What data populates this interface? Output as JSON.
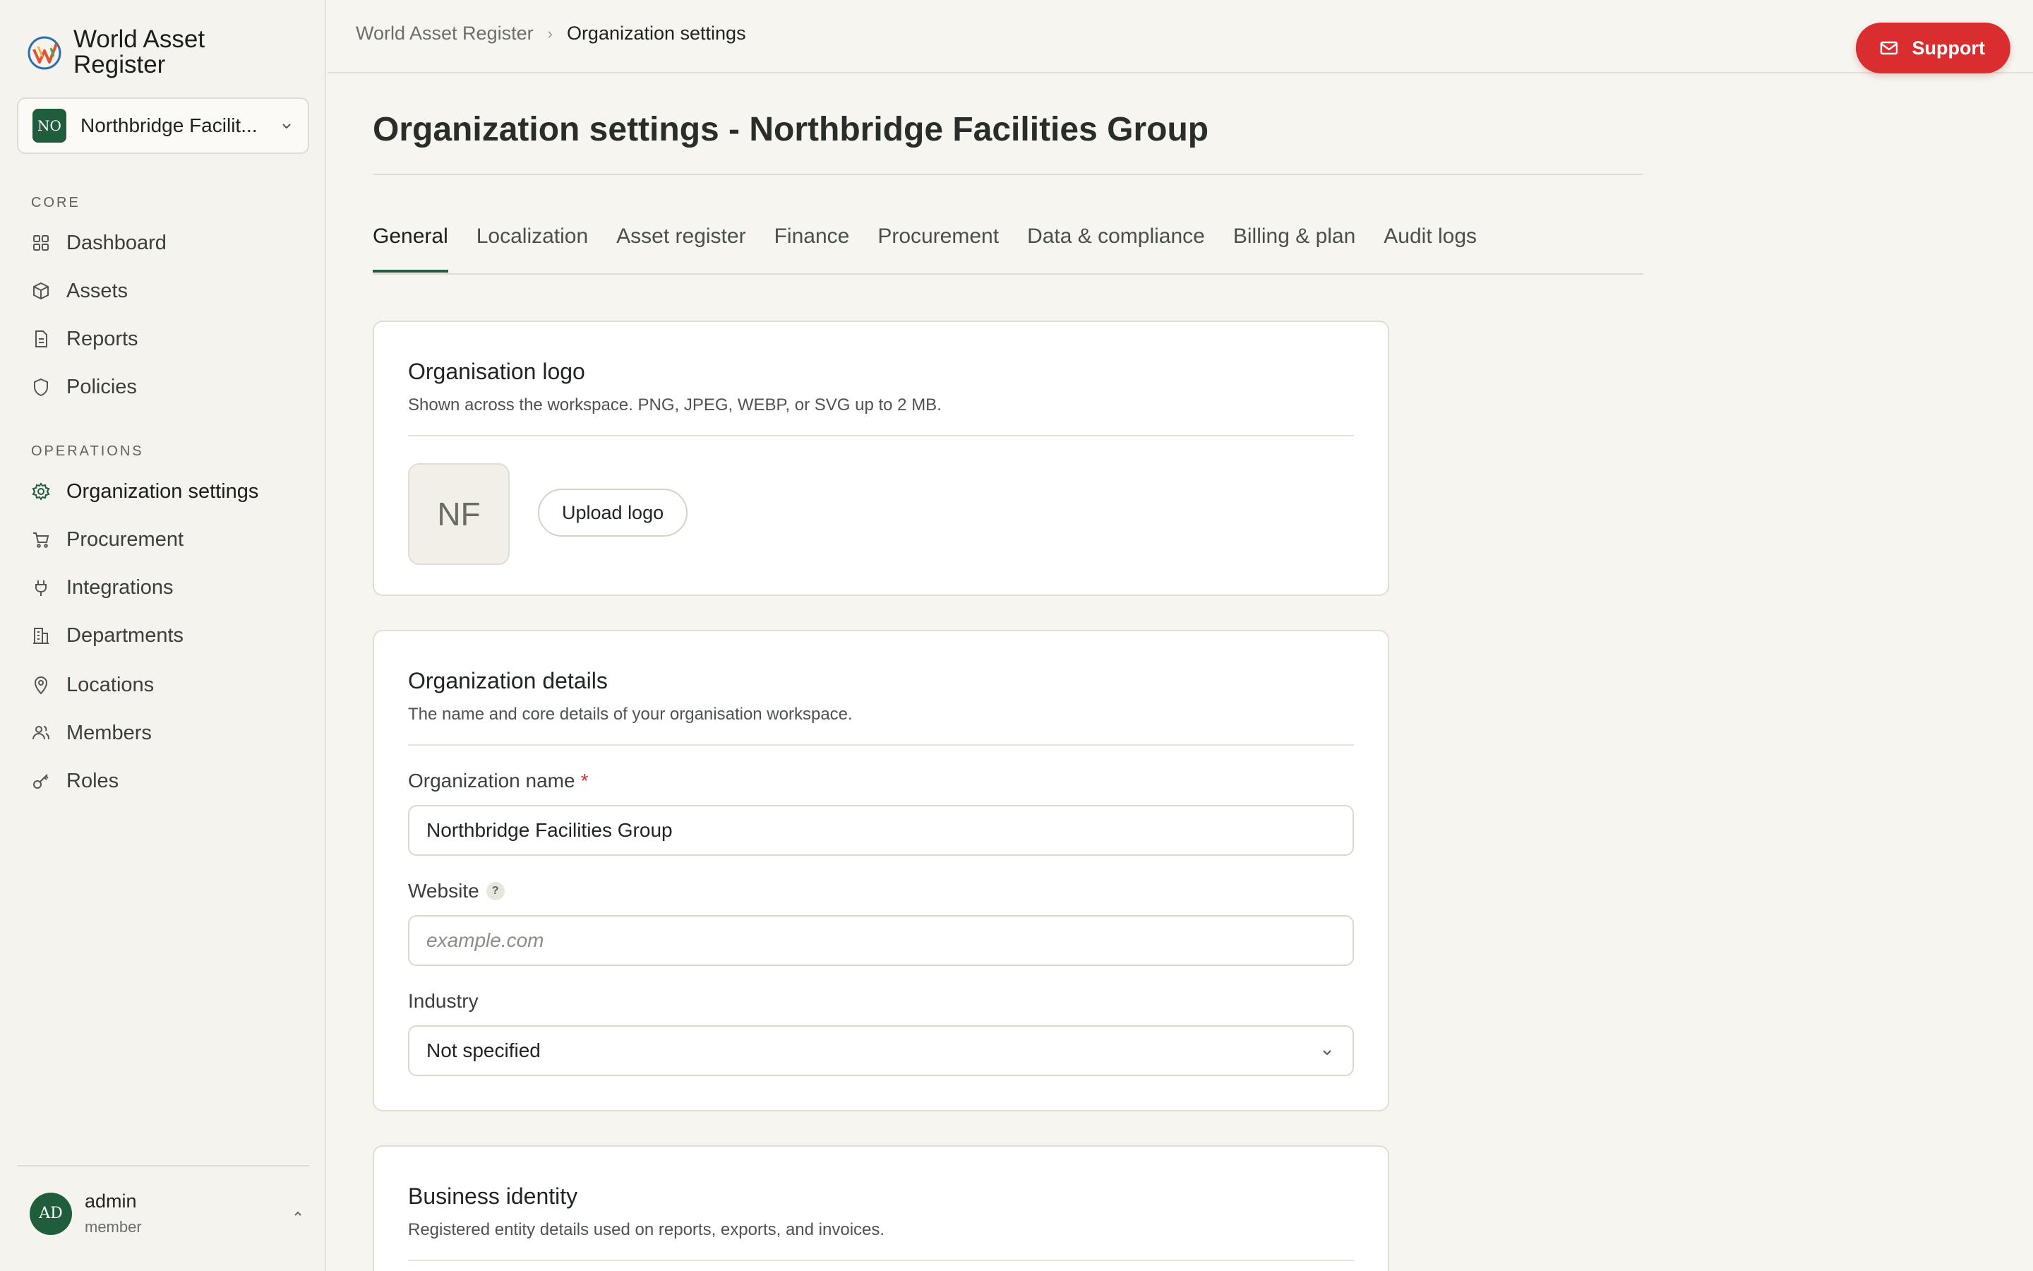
{
  "brand": {
    "name_line1": "World Asset",
    "name_line2": "Register"
  },
  "org_switcher": {
    "badge": "NO",
    "name": "Northbridge Facilit..."
  },
  "sidebar": {
    "core_label": "CORE",
    "core_items": [
      {
        "label": "Dashboard",
        "icon": "grid-icon"
      },
      {
        "label": "Assets",
        "icon": "cube-icon"
      },
      {
        "label": "Reports",
        "icon": "file-text-icon"
      },
      {
        "label": "Policies",
        "icon": "shield-icon"
      }
    ],
    "ops_label": "OPERATIONS",
    "ops_items": [
      {
        "label": "Organization settings",
        "icon": "gear-icon",
        "active": true
      },
      {
        "label": "Procurement",
        "icon": "cart-icon"
      },
      {
        "label": "Integrations",
        "icon": "plug-icon"
      },
      {
        "label": "Departments",
        "icon": "building-icon"
      },
      {
        "label": "Locations",
        "icon": "map-pin-icon"
      },
      {
        "label": "Members",
        "icon": "users-icon"
      },
      {
        "label": "Roles",
        "icon": "key-icon"
      }
    ]
  },
  "user": {
    "initials": "AD",
    "name": "admin",
    "role": "member"
  },
  "breadcrumb": {
    "root": "World Asset Register",
    "current": "Organization settings"
  },
  "support": {
    "label": "Support"
  },
  "page": {
    "title": "Organization settings - Northbridge Facilities Group"
  },
  "tabs": [
    "General",
    "Localization",
    "Asset register",
    "Finance",
    "Procurement",
    "Data & compliance",
    "Billing & plan",
    "Audit logs"
  ],
  "logo_card": {
    "title": "Organisation logo",
    "subtitle": "Shown across the workspace. PNG, JPEG, WEBP, or SVG up to 2 MB.",
    "initials": "NF",
    "upload_label": "Upload logo"
  },
  "details_card": {
    "title": "Organization details",
    "subtitle": "The name and core details of your organisation workspace.",
    "name_label": "Organization name",
    "required_mark": "*",
    "name_value": "Northbridge Facilities Group",
    "website_label": "Website",
    "help_glyph": "?",
    "website_placeholder": "example.com",
    "industry_label": "Industry",
    "industry_value": "Not specified"
  },
  "identity_card": {
    "title": "Business identity",
    "subtitle": "Registered entity details used on reports, exports, and invoices."
  },
  "colors": {
    "accent": "#1f5d3d",
    "danger": "#d92d2f",
    "background": "#f7f5f0"
  }
}
